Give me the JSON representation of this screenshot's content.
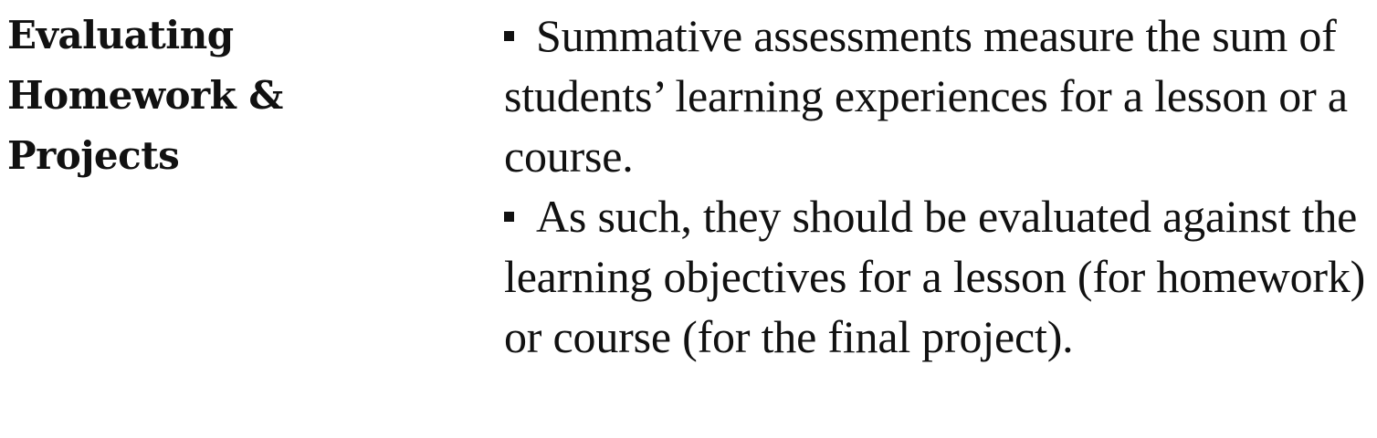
{
  "heading": {
    "lines": [
      "Evaluating",
      "Homework &",
      "Projects"
    ]
  },
  "bullets": [
    {
      "text": "Summative assessments measure the sum of students’ learning experiences for a lesson or a course."
    },
    {
      "text": "As such, they should be evaluated against the learning objectives for a lesson (for homework) or course (for the final project)."
    }
  ]
}
